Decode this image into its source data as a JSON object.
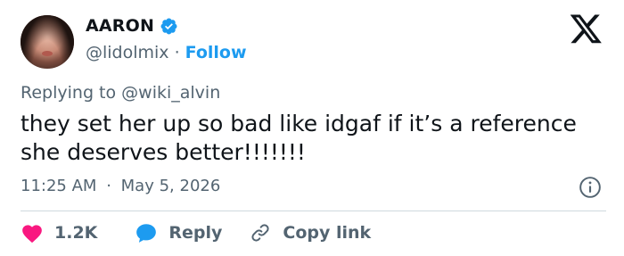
{
  "author": {
    "name": "AARON",
    "handle": "@lidolmix",
    "separator": "·",
    "follow_label": "Follow"
  },
  "tweet": {
    "replying_to": "Replying to @wiki_alvin",
    "text_line1": "they set her up so bad like idgaf if it’s a reference",
    "text_line2": "she deserves better!!!!!!!",
    "time": "11:25 AM",
    "time_separator": "·",
    "date": "May 5, 2026"
  },
  "actions": {
    "likes_count": "1.2K",
    "reply_label": "Reply",
    "copy_link_label": "Copy link"
  },
  "colors": {
    "like": "#f91880",
    "brand_blue": "#1d9bf0",
    "muted": "#536471",
    "divider": "#cfd9de"
  },
  "icons": [
    "verified-badge-icon",
    "x-logo-icon",
    "info-icon",
    "heart-icon",
    "reply-bubble-icon",
    "link-icon"
  ]
}
